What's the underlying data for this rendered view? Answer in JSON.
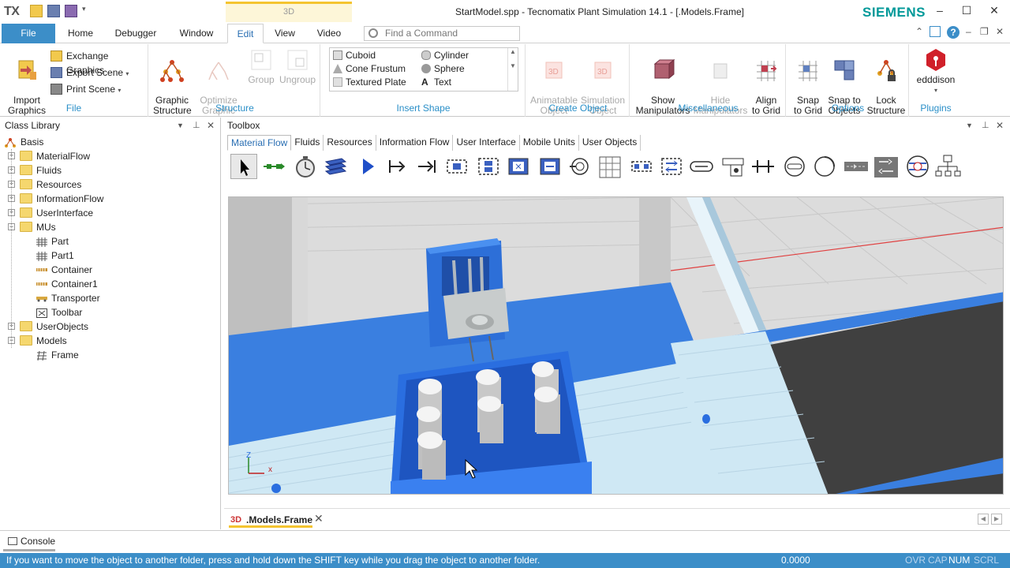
{
  "titlebar": {
    "logo": "TX",
    "context_tab": "3D",
    "title": "StartModel.spp - Tecnomatix Plant Simulation 14.1 - [.Models.Frame]",
    "brand": "SIEMENS"
  },
  "ribbon_tabs": [
    "File",
    "Home",
    "Debugger",
    "Window",
    "Edit",
    "View",
    "Video"
  ],
  "active_tab": "Edit",
  "find_command": {
    "placeholder": "Find a Command"
  },
  "ribbon": {
    "file_group": {
      "label": "File",
      "import_graphics": "Import\nGraphics",
      "exchange_graphics": "Exchange Graphics",
      "export_scene": "Export Scene",
      "print_scene": "Print Scene"
    },
    "structure_group": {
      "label": "Structure",
      "graphic_structure": "Graphic\nStructure",
      "optimize_graphic": "Optimize\nGraphic",
      "group": "Group",
      "ungroup": "Ungroup"
    },
    "insert_shape_group": {
      "label": "Insert Shape",
      "cuboid": "Cuboid",
      "cylinder": "Cylinder",
      "cone_frustum": "Cone Frustum",
      "sphere": "Sphere",
      "textured_plate": "Textured Plate",
      "text": "Text"
    },
    "create_object_group": {
      "label": "Create Object",
      "animatable_object": "Animatable\nObject",
      "simulation_object": "Simulation\nObject"
    },
    "misc_group": {
      "label": "Miscellaneous",
      "show_manipulators": "Show\nManipulators",
      "hide_manipulators": "Hide\nManipulators",
      "align_to_grid": "Align\nto Grid"
    },
    "options_group": {
      "label": "Options",
      "snap_to_grid": "Snap\nto Grid",
      "snap_to_objects": "Snap to\nObjects",
      "lock_structure": "Lock\nStructure"
    },
    "plugins_group": {
      "label": "Plugins",
      "edddison": "edddison"
    }
  },
  "class_library": {
    "title": "Class Library",
    "items": [
      {
        "label": "Basis",
        "level": 0,
        "type": "root"
      },
      {
        "label": "MaterialFlow",
        "level": 1,
        "type": "folder",
        "expander": "+"
      },
      {
        "label": "Fluids",
        "level": 1,
        "type": "folder",
        "expander": "+"
      },
      {
        "label": "Resources",
        "level": 1,
        "type": "folder",
        "expander": "+"
      },
      {
        "label": "InformationFlow",
        "level": 1,
        "type": "folder",
        "expander": "+"
      },
      {
        "label": "UserInterface",
        "level": 1,
        "type": "folder",
        "expander": "+"
      },
      {
        "label": "MUs",
        "level": 1,
        "type": "folder",
        "expander": "−"
      },
      {
        "label": "Part",
        "level": 2,
        "type": "part"
      },
      {
        "label": "Part1",
        "level": 2,
        "type": "part"
      },
      {
        "label": "Container",
        "level": 2,
        "type": "container"
      },
      {
        "label": "Container1",
        "level": 2,
        "type": "container"
      },
      {
        "label": "Transporter",
        "level": 2,
        "type": "transporter"
      },
      {
        "label": "Toolbar",
        "level": 2,
        "type": "toolbar"
      },
      {
        "label": "UserObjects",
        "level": 1,
        "type": "folder",
        "expander": "+"
      },
      {
        "label": "Models",
        "level": 1,
        "type": "folder",
        "expander": "−"
      },
      {
        "label": "Frame",
        "level": 2,
        "type": "frame"
      }
    ]
  },
  "toolbox": {
    "title": "Toolbox",
    "tabs": [
      "Material Flow",
      "Fluids",
      "Resources",
      "Information Flow",
      "User Interface",
      "Mobile Units",
      "User Objects"
    ],
    "active_tab": "Material Flow",
    "tools": [
      "pointer-tool",
      "connector-tool",
      "eventcontroller-tool",
      "flowcontrol-tool",
      "source-tool",
      "drain-tool",
      "singleproc-tool",
      "parallelproc-tool",
      "assembly-tool",
      "dismantle-tool",
      "shift-tool",
      "store-tool",
      "buffer-tool",
      "sorter-tool",
      "cycle-tool",
      "line-tool",
      "angular-converter-tool",
      "turntable-tool",
      "track-tool",
      "turnplate-tool",
      "transfer-station-tool",
      "placebuffer-tool",
      "sorter2-tool",
      "turnstile-tool",
      "assembly-line-tool"
    ]
  },
  "document_tab": {
    "badge": "3D",
    "label": ".Models.Frame"
  },
  "console": {
    "label": "Console"
  },
  "status": {
    "message": "If you want to move the object to another folder, press and hold down the SHIFT key while you drag the object to another folder.",
    "value": "0.0000",
    "indicators": [
      "OVR",
      "CAP",
      "NUM",
      "SCRL"
    ]
  },
  "colors": {
    "accent": "#3c8ec8",
    "group_label": "#2a8fc8",
    "brand": "#009999",
    "conveyor_blue": "#3a7fe0"
  }
}
